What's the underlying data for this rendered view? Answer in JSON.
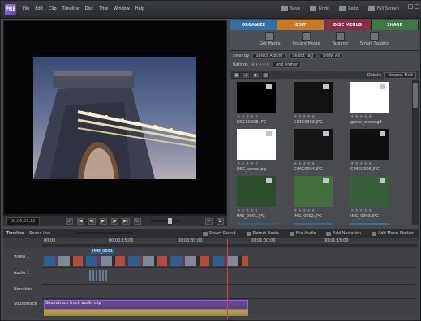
{
  "app": {
    "logo_text": "PRE"
  },
  "menu": [
    "File",
    "Edit",
    "Clip",
    "Timeline",
    "Disc",
    "Title",
    "Window",
    "Help"
  ],
  "toolbar": {
    "save": "Save",
    "undo": "Undo",
    "redo": "Redo",
    "fullscreen": "Full Screen"
  },
  "monitor": {
    "timecode": "00;00;03;12"
  },
  "tabs": [
    {
      "label": "ORGANIZE",
      "color": "#2f6fa8"
    },
    {
      "label": "EDIT",
      "color": "#cc7a1e"
    },
    {
      "label": "DISC MENUS",
      "color": "#8a2d47"
    },
    {
      "label": "SHARE",
      "color": "#3c7a45"
    }
  ],
  "organize": {
    "get_media": "Get Media",
    "instant_movie": "Instant Movie",
    "tagging": "Tagging",
    "smart_tagging": "Smart Tagging"
  },
  "filter": {
    "label": "Filter By",
    "dropdown1": "Select Album",
    "dropdown2": "Select Tag",
    "button": "Show All"
  },
  "rating": {
    "label": "Ratings",
    "dropdown": "and higher"
  },
  "view": {
    "details": "Details",
    "sort": "Newest First"
  },
  "media": [
    {
      "caption": "DSC00008.JPG",
      "bg": "#000000"
    },
    {
      "caption": "CIMG0003.JPG",
      "bg": "#111111"
    },
    {
      "caption": "green_arrow.gif",
      "bg": "#ffffff"
    },
    {
      "caption": "DSC_arrow.jpg",
      "bg": "#ffffff"
    },
    {
      "caption": "CIMG0004.JPG",
      "bg": "#151515"
    },
    {
      "caption": "CIMG0005.JPG",
      "bg": "#101010"
    },
    {
      "caption": "IMG_0001.JPG",
      "bg": "#2b4f2b"
    },
    {
      "caption": "IMG_0002.JPG",
      "bg": "#416f3c"
    },
    {
      "caption": "IMG_0003.JPG",
      "bg": "#37603a"
    },
    {
      "caption": "IMG_0004.JPG",
      "bg": "#2f5e96"
    },
    {
      "caption": "IMG_0005.JPG",
      "bg": "#2f6aa6"
    },
    {
      "caption": "IMG_0006.JPG",
      "bg": "#3372ad"
    }
  ],
  "timeline": {
    "tab1": "Timeline",
    "tab2": "Scene line",
    "smart_sound": "Smart Sound",
    "detect_beats": "Detect Beats",
    "mix_audio": "Mix Audio",
    "add_narration": "Add Narration",
    "add_menu_marker": "Add Menu Marker",
    "ruler": [
      "00;00",
      "00;00;15;00",
      "00;00;30;00",
      "00;01;00;00",
      "00;01;15;00"
    ],
    "tracks": [
      "Video 1",
      "Audio 1",
      "Narration",
      "Soundtrack"
    ],
    "clip_label": "IMG_0001",
    "soundtrack_label": "Soundtrack track audio clip"
  }
}
